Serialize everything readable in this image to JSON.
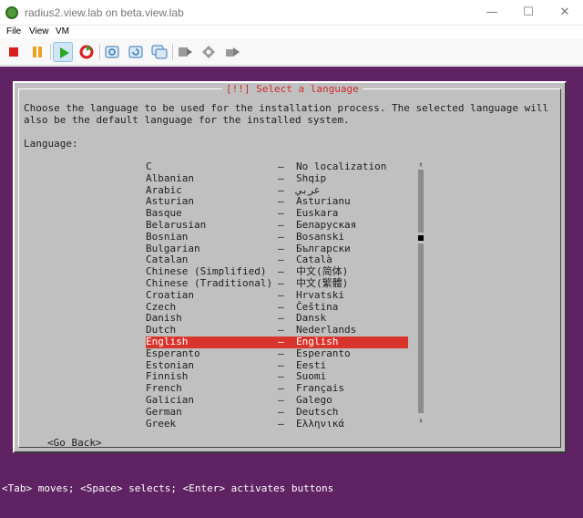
{
  "window": {
    "title": "radius2.view.lab on beta.view.lab",
    "minimize_glyph": "—",
    "maximize_glyph": "☐",
    "close_glyph": "✕"
  },
  "menu": [
    "File",
    "View",
    "VM"
  ],
  "toolbar": {
    "icons": [
      "stop-icon",
      "pause-icon",
      "play-icon",
      "reset-icon",
      "snapshot-icon",
      "revert-snapshot-icon",
      "manage-snapshots-icon",
      "send-ctrl-alt-del-icon",
      "settings-icon",
      "removable-devices-icon"
    ],
    "active": "play-icon"
  },
  "installer": {
    "title": "[!!] Select a language",
    "description": "Choose the language to be used for the installation process. The selected language will also be the default language for the installed system.",
    "language_label": "Language:",
    "languages": [
      {
        "name": "C",
        "native": "No localization"
      },
      {
        "name": "Albanian",
        "native": "Shqip"
      },
      {
        "name": "Arabic",
        "native": "عربي"
      },
      {
        "name": "Asturian",
        "native": "Asturianu"
      },
      {
        "name": "Basque",
        "native": "Euskara"
      },
      {
        "name": "Belarusian",
        "native": "Беларуская"
      },
      {
        "name": "Bosnian",
        "native": "Bosanski"
      },
      {
        "name": "Bulgarian",
        "native": "Български"
      },
      {
        "name": "Catalan",
        "native": "Català"
      },
      {
        "name": "Chinese (Simplified)",
        "native": "中文(简体)"
      },
      {
        "name": "Chinese (Traditional)",
        "native": "中文(繁體)"
      },
      {
        "name": "Croatian",
        "native": "Hrvatski"
      },
      {
        "name": "Czech",
        "native": "Čeština"
      },
      {
        "name": "Danish",
        "native": "Dansk"
      },
      {
        "name": "Dutch",
        "native": "Nederlands"
      },
      {
        "name": "English",
        "native": "English"
      },
      {
        "name": "Esperanto",
        "native": "Esperanto"
      },
      {
        "name": "Estonian",
        "native": "Eesti"
      },
      {
        "name": "Finnish",
        "native": "Suomi"
      },
      {
        "name": "French",
        "native": "Français"
      },
      {
        "name": "Galician",
        "native": "Galego"
      },
      {
        "name": "German",
        "native": "Deutsch"
      },
      {
        "name": "Greek",
        "native": "Ελληνικά"
      }
    ],
    "dash": "–",
    "selected_index": 15,
    "scroll_up": "↑",
    "scroll_down": "↓",
    "go_back": "<Go Back>",
    "status": "<Tab> moves; <Space> selects; <Enter> activates buttons"
  },
  "colors": {
    "vm_background": "#5f2263",
    "dialog_background": "#c0c0c0",
    "selection": "#d9342b",
    "title_text": "#d02b2b"
  }
}
